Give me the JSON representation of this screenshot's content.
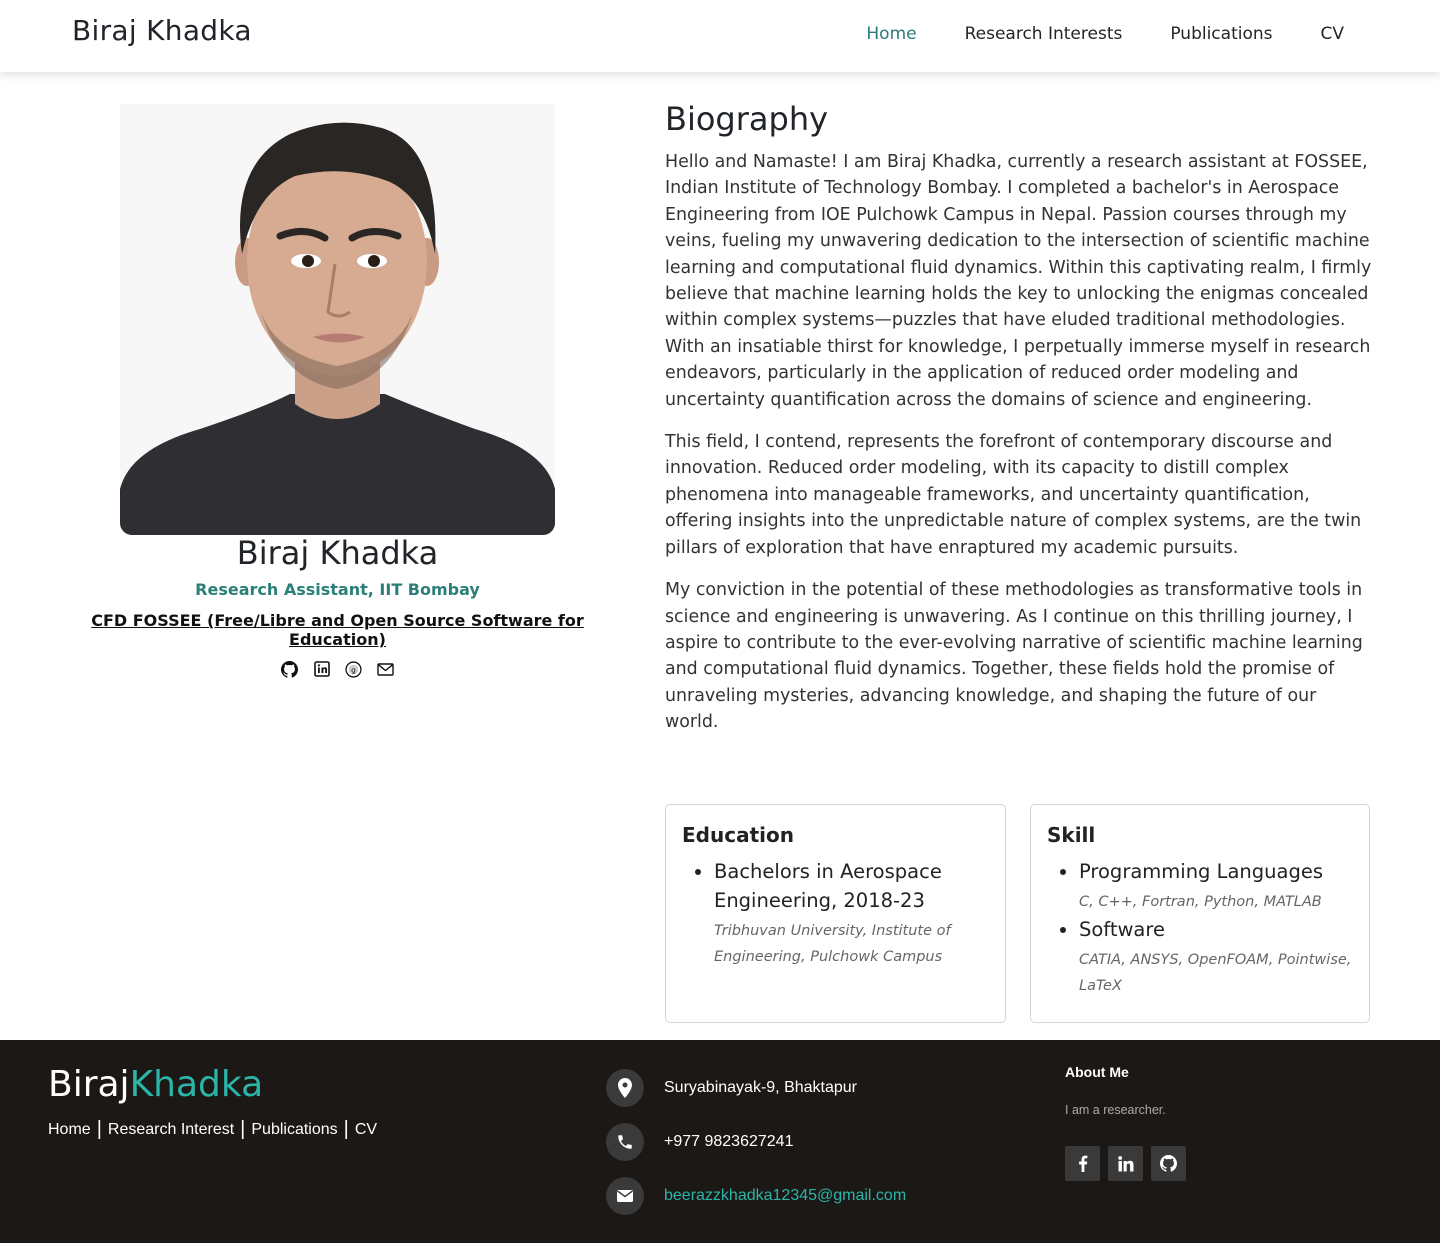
{
  "header": {
    "brand": "Biraj Khadka",
    "nav": [
      {
        "label": "Home",
        "active": true
      },
      {
        "label": "Research Interests"
      },
      {
        "label": "Publications"
      },
      {
        "label": "CV"
      }
    ]
  },
  "profile": {
    "name": "Biraj Khadka",
    "role": "Research Assistant, IIT Bombay",
    "org": "CFD FOSSEE (Free/Libre and Open Source Software for Education)",
    "social_icons": [
      "github-icon",
      "linkedin-icon",
      "google-scholar-icon",
      "mail-icon"
    ]
  },
  "biography": {
    "title": "Biography",
    "paragraphs": [
      "Hello and Namaste! I am Biraj Khadka, currently a research assistant at FOSSEE, Indian Institute of Technology Bombay. I completed a bachelor's in Aerospace Engineering from IOE Pulchowk Campus in Nepal. Passion courses through my veins, fueling my unwavering dedication to the intersection of scientific machine learning and computational fluid dynamics. Within this captivating realm, I firmly believe that machine learning holds the key to unlocking the enigmas concealed within complex systems—puzzles that have eluded traditional methodologies. With an insatiable thirst for knowledge, I perpetually immerse myself in research endeavors, particularly in the application of reduced order modeling and uncertainty quantification across the domains of science and engineering.",
      "This field, I contend, represents the forefront of contemporary discourse and innovation. Reduced order modeling, with its capacity to distill complex phenomena into manageable frameworks, and uncertainty quantification, offering insights into the unpredictable nature of complex systems, are the twin pillars of exploration that have enraptured my academic pursuits.",
      "My conviction in the potential of these methodologies as transformative tools in science and engineering is unwavering. As I continue on this thrilling journey, I aspire to contribute to the ever-evolving narrative of scientific machine learning and computational fluid dynamics. Together, these fields hold the promise of unraveling mysteries, advancing knowledge, and shaping the future of our world."
    ]
  },
  "education": {
    "title": "Education",
    "items": [
      {
        "label": "Bachelors in Aerospace Engineering, 2018-23",
        "detail": "Tribhuvan University, Institute of Engineering, Pulchowk Campus"
      }
    ]
  },
  "skill": {
    "title": "Skill",
    "items": [
      {
        "label": "Programming Languages",
        "detail": "C, C++, Fortran, Python, MATLAB"
      },
      {
        "label": "Software",
        "detail": "CATIA, ANSYS, OpenFOAM, Pointwise, LaTeX"
      }
    ]
  },
  "footer": {
    "brand_first": "Biraj",
    "brand_second": "Khadka",
    "links": [
      "Home",
      "Research Interest",
      "Publications",
      "CV"
    ],
    "separator": "|",
    "address": "Suryabinayak-9, Bhaktapur",
    "phone": "+977 9823627241",
    "email": "beerazzkhadka12345@gmail.com",
    "about_title": "About Me",
    "about_text": "I am a researcher.",
    "social_icons": [
      "facebook-icon",
      "linkedin-icon",
      "github-icon"
    ],
    "accent_color": "#2bb5a8",
    "background_color": "#1c1816"
  }
}
